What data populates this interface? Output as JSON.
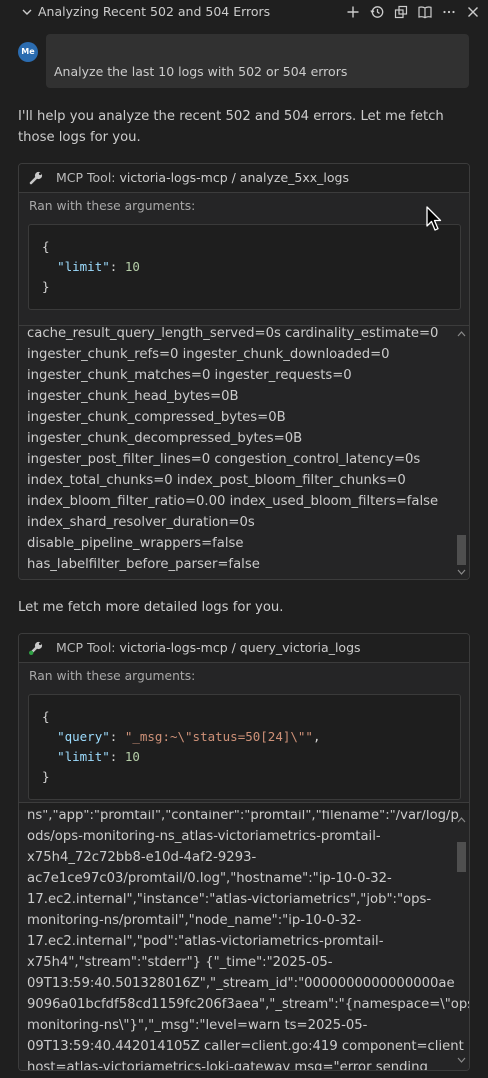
{
  "header": {
    "title": "Analyzing Recent 502 and 504 Errors",
    "icons": [
      "plus-icon",
      "history-icon",
      "new-window-icon",
      "book-icon",
      "more-icon",
      "close-icon"
    ]
  },
  "user": {
    "avatar": "Me",
    "message": "Analyze the last 10 logs with 502 or 504 errors"
  },
  "assistant": {
    "intro": "I'll help you analyze the recent 502 and 504 errors. Let me fetch those logs for you.",
    "followup": "Let me fetch more detailed logs for you."
  },
  "tool1": {
    "label": "MCP Tool:",
    "name": "victoria-logs-mcp / analyze_5xx_logs",
    "args_label": "Ran with these arguments:",
    "args": {
      "open": "{",
      "key": "\"limit\"",
      "sep": ": ",
      "value": "10",
      "close": "}"
    },
    "output": [
      "cache_result_query_length_served=0s cardinality_estimate=0",
      "ingester_chunk_refs=0 ingester_chunk_downloaded=0",
      "ingester_chunk_matches=0 ingester_requests=0",
      "ingester_chunk_head_bytes=0B",
      "ingester_chunk_compressed_bytes=0B",
      "ingester_chunk_decompressed_bytes=0B",
      "ingester_post_filter_lines=0 congestion_control_latency=0s",
      "index_total_chunks=0 index_post_bloom_filter_chunks=0",
      "index_bloom_filter_ratio=0.00 index_used_bloom_filters=false",
      "index_shard_resolver_duration=0s",
      "disable_pipeline_wrappers=false",
      "has_labelfilter_before_parser=false"
    ]
  },
  "tool2": {
    "label": "MCP Tool:",
    "name": "victoria-logs-mcp / query_victoria_logs",
    "args_label": "Ran with these arguments:",
    "args": {
      "open": "{",
      "query_key": "\"query\"",
      "query_value": "\"_msg:~\\\"status=50[24]\\\"\"",
      "sep": ": ",
      "comma": ",",
      "limit_key": "\"limit\"",
      "limit_value": "10",
      "close": "}"
    },
    "output": [
      "ns\",\"app\":\"promtail\",\"container\":\"promtail\",\"filename\":\"/var/log/p",
      "ods/ops-monitoring-ns_atlas-victoriametrics-promtail-",
      "x75h4_72c72bb8-e10d-4af2-9293-",
      "ac7e1ce97c03/promtail/0.log\",\"hostname\":\"ip-10-0-32-",
      "17.ec2.internal\",\"instance\":\"atlas-victoriametrics\",\"job\":\"ops-",
      "monitoring-ns/promtail\",\"node_name\":\"ip-10-0-32-",
      "17.ec2.internal\",\"pod\":\"atlas-victoriametrics-promtail-",
      "x75h4\",\"stream\":\"stderr\"} {\"_time\":\"2025-05-",
      "09T13:59:40.501328016Z\",\"_stream_id\":\"0000000000000000ae",
      "9096a01bcfdf58cd1159fc206f3aea\",\"_stream\":\"{namespace=\\\"ops-",
      "monitoring-ns\\\"}\",\"_msg\":\"level=warn ts=2025-05-",
      "09T13:59:40.442014105Z caller=client.go:419 component=client",
      "host=atlas-victoriametrics-loki-gateway msg=\"error sending"
    ]
  }
}
